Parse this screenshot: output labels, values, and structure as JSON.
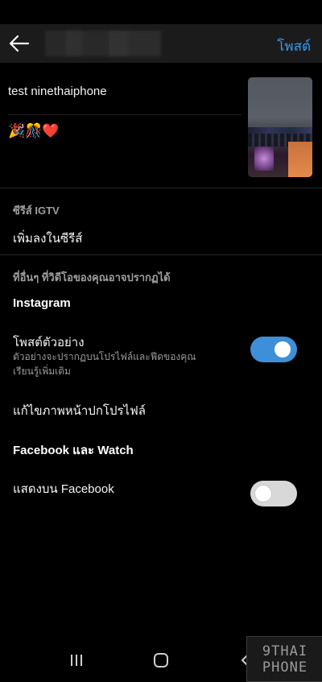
{
  "header": {
    "back_icon": "arrow-left-icon",
    "post_label": "โพสต์"
  },
  "post": {
    "caption": "test ninethaiphone",
    "emoji": "🎉🎊❤️"
  },
  "igtv_series": {
    "section_label": "ซีรีส์ IGTV",
    "add_label": "เพิ่มลงในซีรีส์"
  },
  "other_places": {
    "section_label": "ที่อื่นๆ ที่วิดีโอของคุณอาจปรากฏได้",
    "instagram_heading": "Instagram",
    "preview_title": "โพสต์ตัวอย่าง",
    "preview_desc": "ตัวอย่างจะปรากฏบนโปรไฟล์และฟีดของคุณ",
    "learn_more": "เรียนรู้เพิ่มเติม",
    "preview_toggle_on": true,
    "edit_cover_label": "แก้ไขภาพหน้าปกโปรไฟล์",
    "facebook_heading": "Facebook และ Watch",
    "show_on_facebook_label": "แสดงบน Facebook",
    "facebook_toggle_on": false
  },
  "navbar": {
    "recents_icon": "recent-apps-icon",
    "home_icon": "home-icon",
    "back_icon": "back-icon"
  },
  "watermark": {
    "line1": "9THAI",
    "line2": "PHONE"
  },
  "colors": {
    "accent": "#3897f0",
    "toggle_on": "#3d8fd8",
    "background": "#000000"
  }
}
